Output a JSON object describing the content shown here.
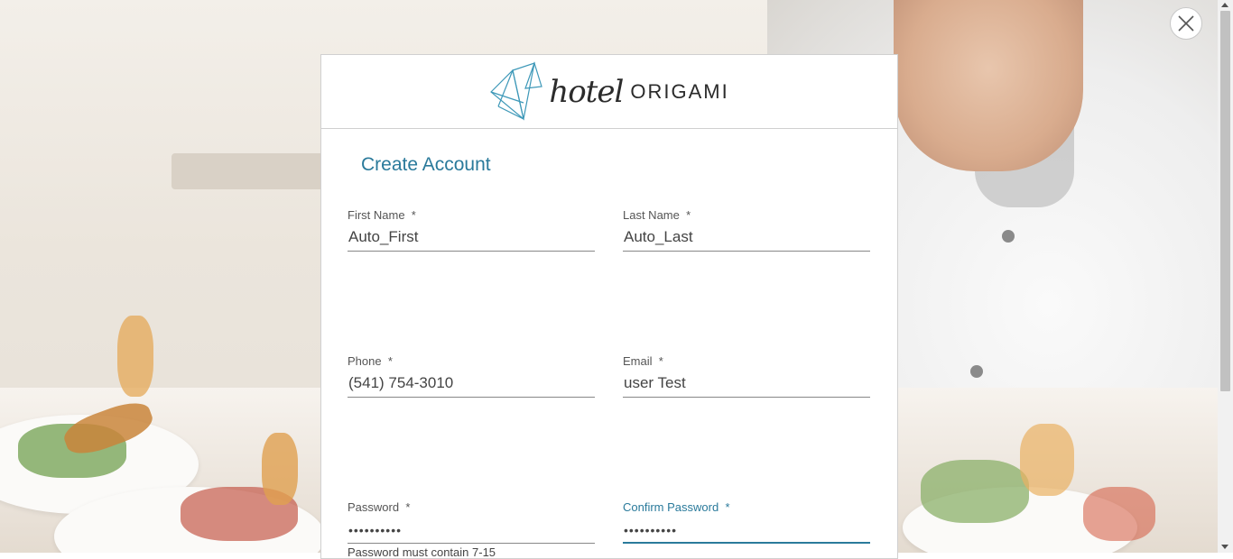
{
  "brand": {
    "logo_icon": "origami-bird-icon",
    "logo_text_1": "hotel",
    "logo_text_2": "ORIGAMI",
    "accent_color": "#2a7a9b"
  },
  "close_button": {
    "icon": "close-icon"
  },
  "form": {
    "title": "Create Account",
    "fields": {
      "first_name": {
        "label": "First Name",
        "required": "*",
        "value": "Auto_First"
      },
      "last_name": {
        "label": "Last Name",
        "required": "*",
        "value": "Auto_Last"
      },
      "phone": {
        "label": "Phone",
        "required": "*",
        "value": "(541) 754-3010"
      },
      "email": {
        "label": "Email",
        "required": "*",
        "value": "user Test"
      },
      "password": {
        "label": "Password",
        "required": "*",
        "value": "••••••••••"
      },
      "confirm_password": {
        "label": "Confirm Password",
        "required": "*",
        "value": "••••••••••"
      }
    },
    "password_hint": "Password must contain 7-15"
  }
}
